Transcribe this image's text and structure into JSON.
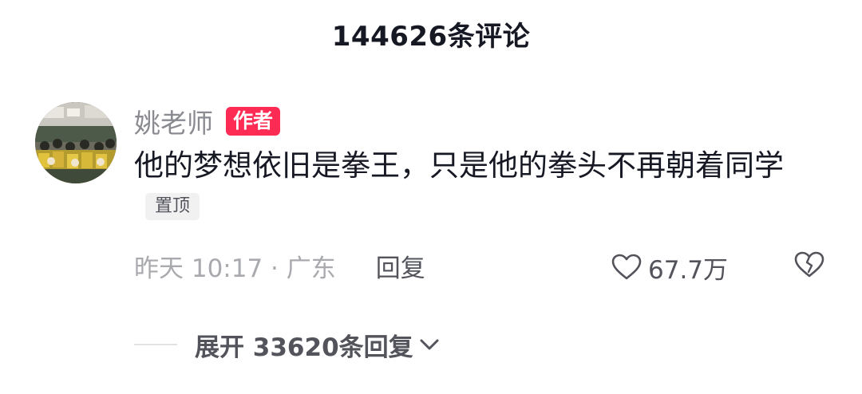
{
  "header": {
    "title": "144626条评论"
  },
  "comment": {
    "author_name": "姚老师",
    "author_badge": "作者",
    "text": "他的梦想依旧是拳王，只是他的拳头不再朝着同学",
    "pinned_label": "置顶",
    "time_location": "昨天 10:17 · 广东",
    "reply_label": "回复",
    "like_count": "67.7万",
    "icons": {
      "avatar": "classroom-photo-avatar",
      "like": "heart-outline-icon",
      "dislike": "broken-heart-icon",
      "expand": "chevron-down-icon"
    }
  },
  "replies": {
    "expand_label": "展开 33620条回复"
  },
  "colors": {
    "accent": "#fe2c55",
    "text": "#161823",
    "muted": "#8a8b91"
  }
}
